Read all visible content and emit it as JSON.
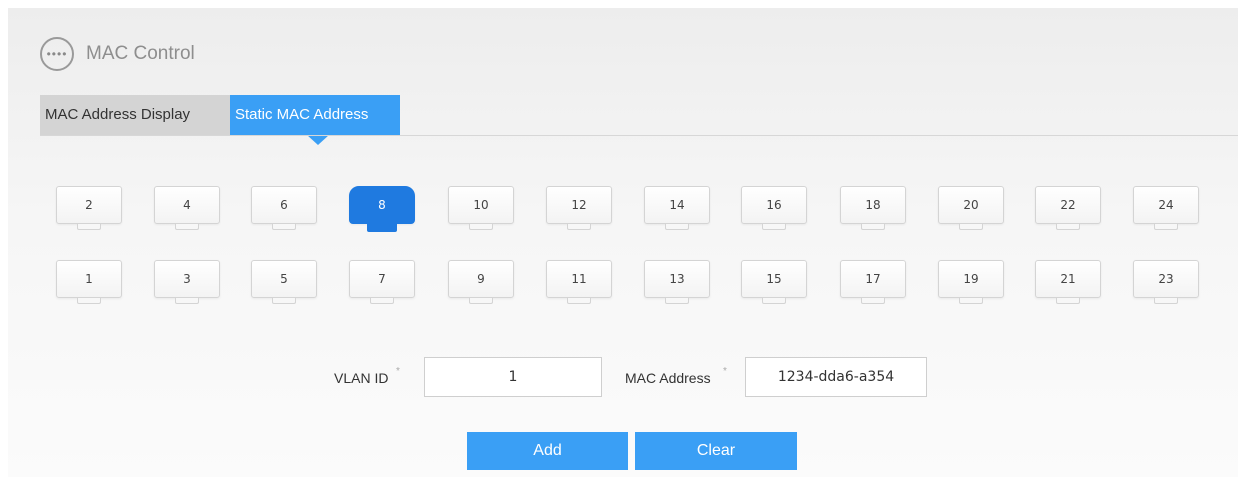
{
  "header": {
    "title": "MAC Control",
    "icon": "more-dots-icon"
  },
  "tabs": [
    {
      "label": "MAC Address Display",
      "active": false
    },
    {
      "label": "Static MAC Address",
      "active": true
    }
  ],
  "ports": {
    "top_row": [
      "2",
      "4",
      "6",
      "8",
      "10",
      "12",
      "14",
      "16",
      "18",
      "20",
      "22",
      "24"
    ],
    "bottom_row": [
      "1",
      "3",
      "5",
      "7",
      "9",
      "11",
      "13",
      "15",
      "17",
      "19",
      "21",
      "23"
    ],
    "selected": "8"
  },
  "form": {
    "vlan_label": "VLAN ID",
    "vlan_value": "1",
    "mac_label": "MAC Address",
    "mac_value": "1234-dda6-a354",
    "required_mark": "*"
  },
  "buttons": {
    "add": "Add",
    "clear": "Clear"
  },
  "colors": {
    "accent": "#3a9ff5",
    "selected_port": "#1f7ae0"
  }
}
